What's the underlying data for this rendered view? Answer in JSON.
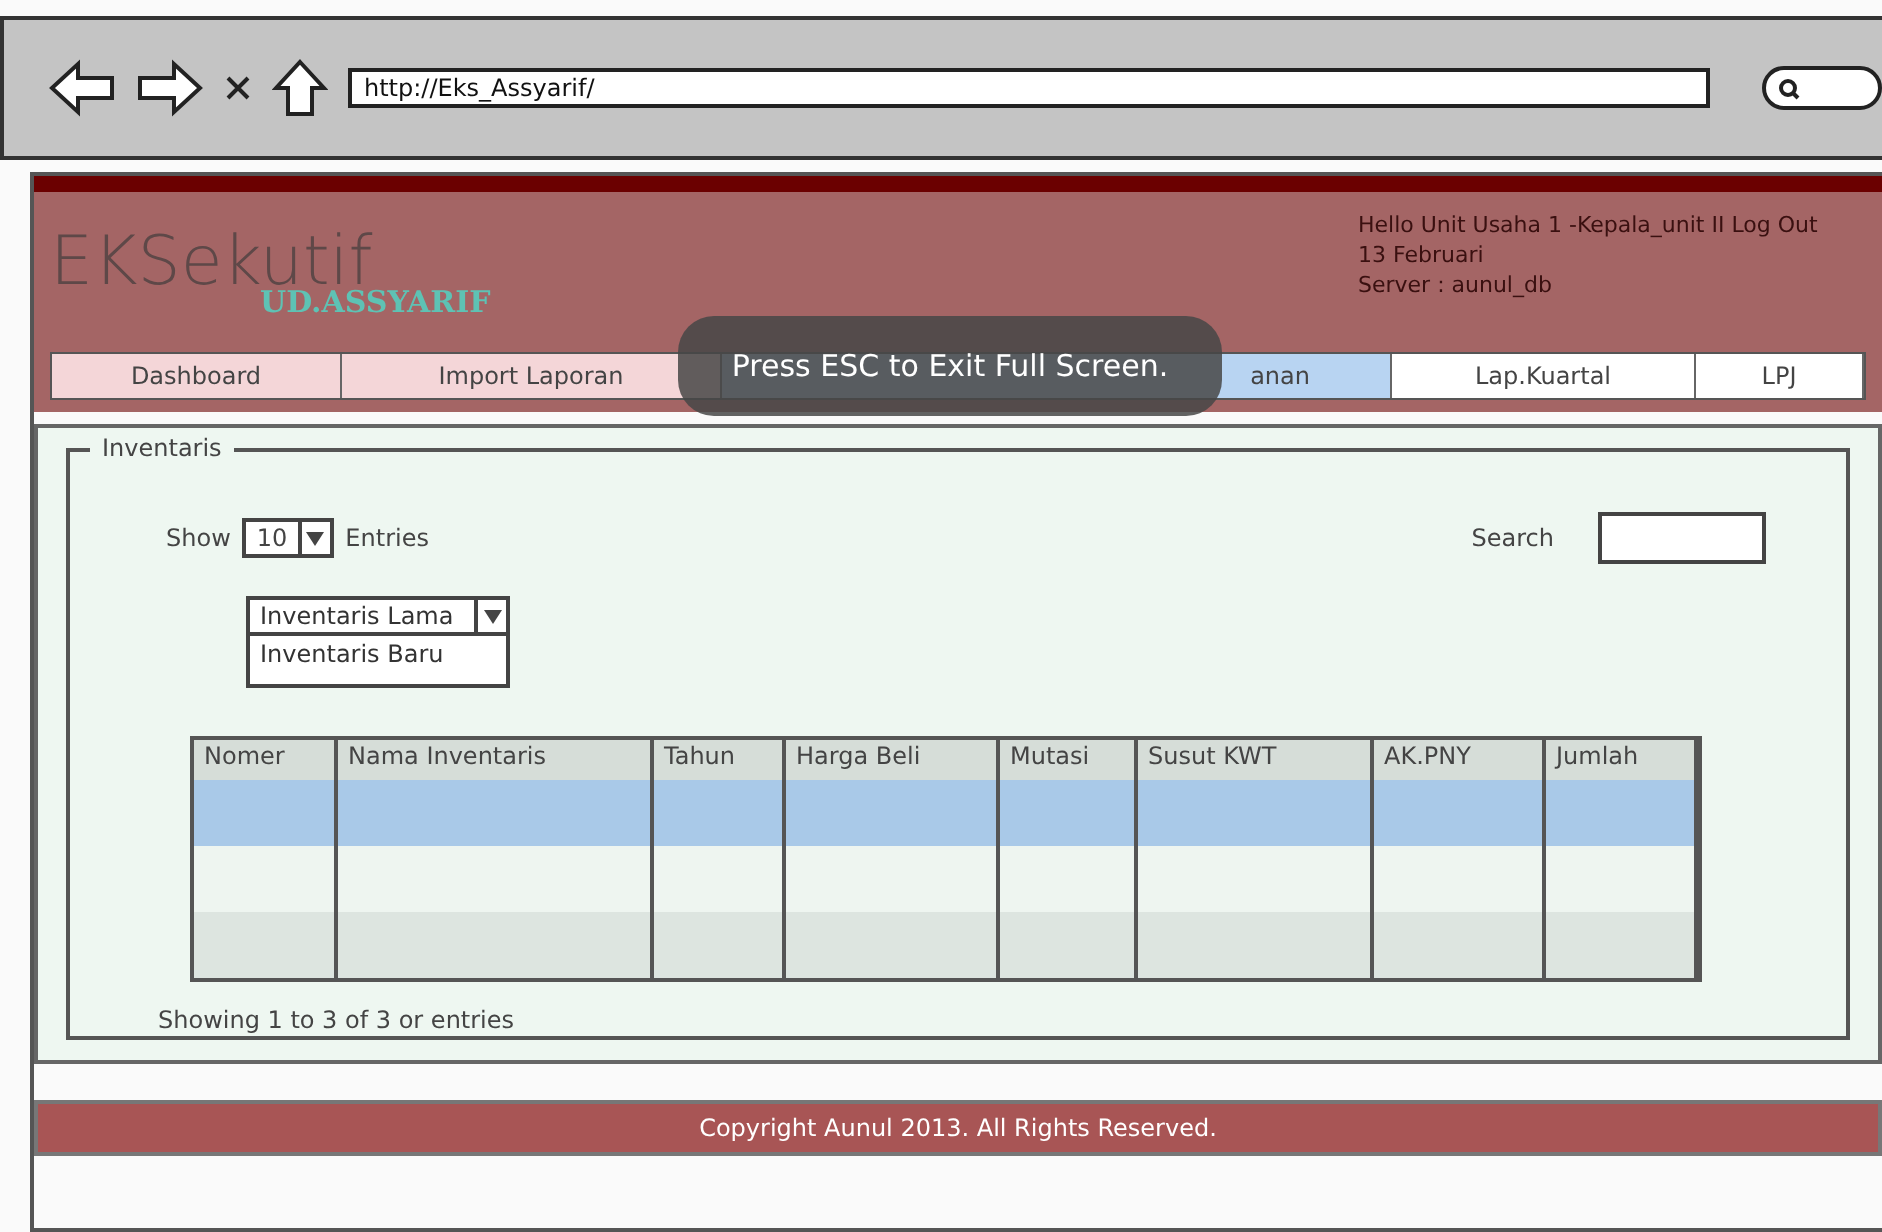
{
  "browser": {
    "url": "http://Eks_Assyarif/"
  },
  "header": {
    "logo": "EKSekutif",
    "subtitle": "UD.ASSYARIF",
    "greeting": "Hello Unit Usaha 1 -Kepala_unit II Log Out",
    "date": "13 Februari",
    "server": "Server : aunul_db"
  },
  "nav": [
    {
      "label": "Dashboard",
      "selected": false,
      "tinted": true
    },
    {
      "label": "Import Laporan",
      "selected": false,
      "tinted": true
    },
    {
      "label": "anan",
      "selected": true,
      "tinted": false
    },
    {
      "label": "Lap.Kuartal",
      "selected": false,
      "tinted": false
    },
    {
      "label": "LPJ",
      "selected": false,
      "tinted": false
    }
  ],
  "fullscreen_notice": "Press ESC to Exit Full Screen.",
  "panel": {
    "title": "Inventaris",
    "show_label": "Show",
    "entries_value": "10",
    "entries_label": "Entries",
    "search_label": "Search",
    "category_select": {
      "value": "Inventaris Lama",
      "options": [
        "Inventaris Baru"
      ]
    }
  },
  "table": {
    "columns": [
      "Nomer",
      "Nama Inventaris",
      "Tahun",
      "Harga Beli",
      "Mutasi",
      "Susut KWT",
      "AK.PNY",
      "Jumlah"
    ],
    "rows": [
      {
        "selected": true
      },
      {
        "selected": false
      },
      {
        "selected": false
      }
    ]
  },
  "table_info": "Showing 1 to 3 of 3 or entries",
  "footer": "Copyright Aunul 2013. All Rights Reserved."
}
